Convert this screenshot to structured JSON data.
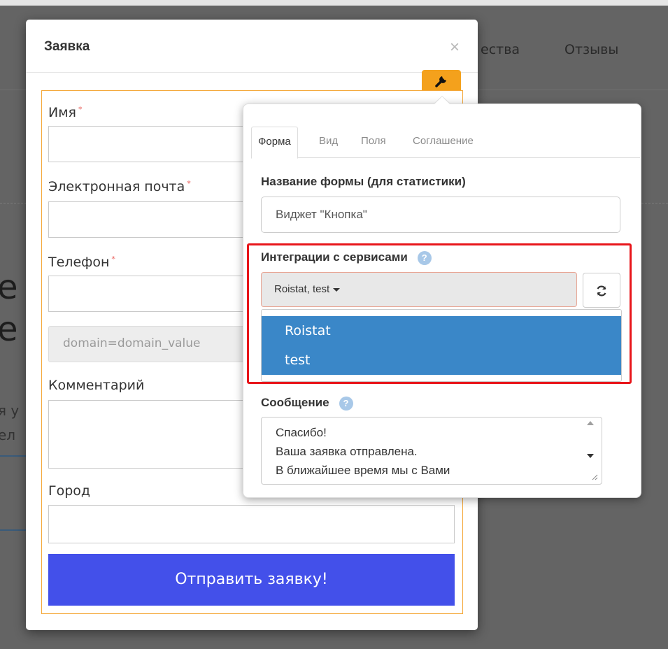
{
  "background": {
    "nav_items": [
      "ества",
      "Отзывы"
    ],
    "partial_texts": [
      "е",
      "е",
      "я у",
      "ел"
    ]
  },
  "modal": {
    "title": "Заявка",
    "close_icon": "×",
    "fields": {
      "name_label": "Имя",
      "email_label": "Электронная почта",
      "phone_label": "Телефон",
      "hidden_value": "domain=domain_value",
      "comment_label": "Комментарий",
      "city_label": "Город",
      "required_mark": "*"
    },
    "submit_label": "Отправить заявку!",
    "submit_color": "#4350ea"
  },
  "settings_button": {
    "icon": "wrench-icon",
    "color": "#f4a11c"
  },
  "popover": {
    "tabs": [
      "Форма",
      "Вид",
      "Поля",
      "Соглашение"
    ],
    "active_tab": "Форма",
    "form_name_label": "Название формы (для статистики)",
    "form_name_value": "Виджет \"Кнопка\"",
    "integrations_label": "Интеграции с сервисами",
    "integrations_selected": "Roistat, test",
    "integrations_options": [
      "Roistat",
      "test"
    ],
    "message_label": "Сообщение",
    "message_lines": [
      "Спасибо!",
      "Ваша заявка отправлена.",
      "В ближайшее время мы с Вами"
    ],
    "help_icon": "?",
    "refresh_icon": "refresh-icon"
  },
  "highlight_color": "#e8151a"
}
